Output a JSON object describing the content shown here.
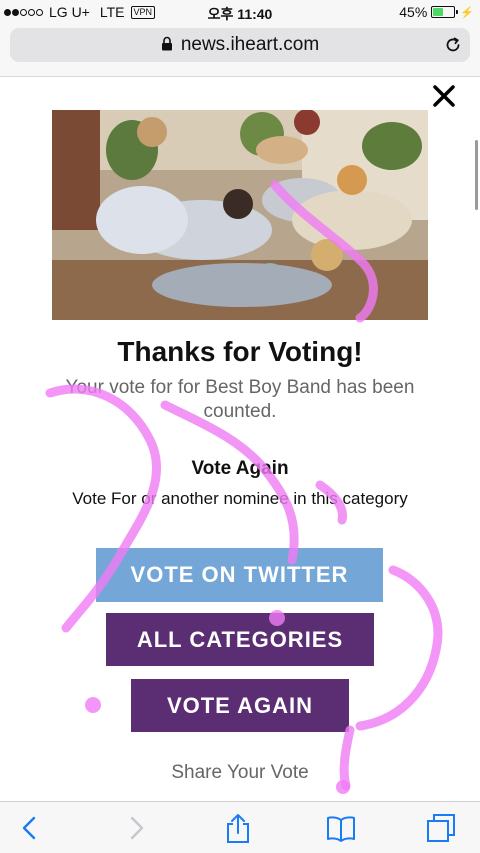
{
  "status_bar": {
    "carrier": "LG U+",
    "network": "LTE",
    "vpn": "VPN",
    "time": "오후 11:40",
    "battery": "45%",
    "battery_level": 0.45,
    "signal_bars_filled": 2,
    "signal_bars_total": 5
  },
  "browser": {
    "url": "news.iheart.com",
    "lock_icon": "lock-icon",
    "reload_icon": "reload-icon"
  },
  "modal": {
    "close_icon": "close-icon",
    "title": "Thanks for Voting!",
    "subtitle": "Your vote for for Best Boy Band has been counted.",
    "vote_again_heading": "Vote Again",
    "vote_again_text": "Vote For or another nominee in this category",
    "buttons": {
      "twitter": "VOTE ON TWITTER",
      "categories": "ALL CATEGORIES",
      "vote_again": "VOTE AGAIN"
    },
    "share_label": "Share Your Vote"
  },
  "toolbar": {
    "back_icon": "back-icon",
    "forward_icon": "forward-icon",
    "share_icon": "share-icon",
    "bookmarks_icon": "bookmarks-icon",
    "tabs_icon": "tabs-icon"
  },
  "colors": {
    "twitter_button": "#74a7d8",
    "purple_button": "#5b2e74",
    "ios_blue": "#1a7cf5",
    "doodle_pink": "#f07cf5",
    "battery_green": "#4cd964"
  }
}
